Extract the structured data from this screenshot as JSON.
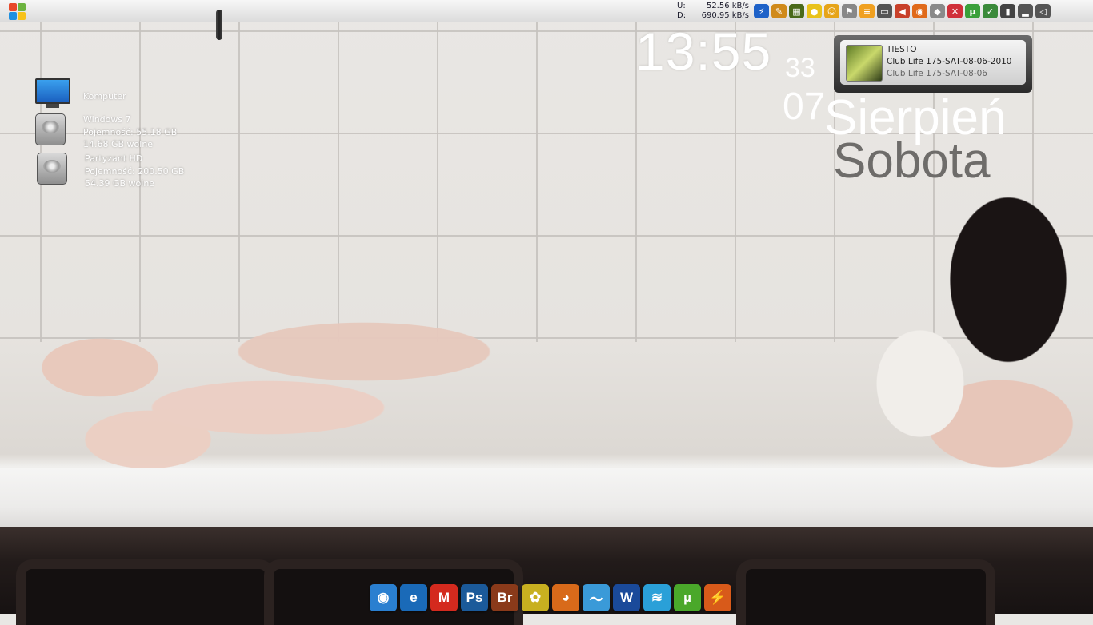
{
  "taskbar": {
    "net_upload_label": "U:",
    "net_upload_value": "52.56 kB/s",
    "net_download_label": "D:",
    "net_download_value": "690.95 kB/s"
  },
  "tray_icons": [
    {
      "name": "download-manager-icon",
      "glyph": "⚡",
      "color": "#1e62c8"
    },
    {
      "name": "ticket-icon",
      "glyph": "✎",
      "color": "#d08a1a"
    },
    {
      "name": "image-viewer-icon",
      "glyph": "▦",
      "color": "#4a6a1a"
    },
    {
      "name": "lightbulb-icon",
      "glyph": "●",
      "color": "#e9c21a"
    },
    {
      "name": "smiley-icon",
      "glyph": "☺",
      "color": "#e6a419"
    },
    {
      "name": "flag-icon",
      "glyph": "⚑",
      "color": "#888888"
    },
    {
      "name": "menu-icon",
      "glyph": "≡",
      "color": "#f0a020"
    },
    {
      "name": "projector-icon",
      "glyph": "▭",
      "color": "#555555"
    },
    {
      "name": "speaker-icon",
      "glyph": "◀",
      "color": "#c8402a"
    },
    {
      "name": "firefox-icon",
      "glyph": "◉",
      "color": "#e06a1a"
    },
    {
      "name": "droplet-icon",
      "glyph": "◆",
      "color": "#8a8a8a"
    },
    {
      "name": "stop-icon",
      "glyph": "✕",
      "color": "#d0303a"
    },
    {
      "name": "utorrent-tray-icon",
      "glyph": "µ",
      "color": "#3aa03a"
    },
    {
      "name": "security-shield-icon",
      "glyph": "✓",
      "color": "#3a8a3a"
    },
    {
      "name": "usb-icon",
      "glyph": "▮",
      "color": "#444444"
    },
    {
      "name": "signal-bars-icon",
      "glyph": "▂",
      "color": "#555555"
    },
    {
      "name": "volume-icon",
      "glyph": "◁",
      "color": "#555555"
    }
  ],
  "drives": [
    {
      "name": "Komputer"
    },
    {
      "name": "Windows 7",
      "capacity": "Pojemność: 55.18 GB",
      "free": "14.68 GB wolne"
    },
    {
      "name": "Partyzant HD",
      "capacity": "Pojemność: 200.50 GB",
      "free": "54.39 GB wolne"
    }
  ],
  "clock": {
    "time": "13:55",
    "seconds": "33",
    "day": "07",
    "month": "Sierpień",
    "weekday": "Sobota"
  },
  "player": {
    "artist": "TIESTO",
    "title": "Club Life 175-SAT-08-06-2010",
    "album": "Club Life 175-SAT-08-06"
  },
  "dock_apps": [
    {
      "name": "chrome-icon",
      "glyph": "◉",
      "color": "#2a7fd0"
    },
    {
      "name": "internet-explorer-icon",
      "glyph": "e",
      "color": "#1a6ab8"
    },
    {
      "name": "gmail-icon",
      "glyph": "M",
      "color": "#d42a1e"
    },
    {
      "name": "photoshop-icon",
      "glyph": "Ps",
      "color": "#1b5a9a"
    },
    {
      "name": "bridge-icon",
      "glyph": "Br",
      "color": "#8a3a1a"
    },
    {
      "name": "picasa-icon",
      "glyph": "✿",
      "color": "#c8b020"
    },
    {
      "name": "firefox-icon",
      "glyph": "◕",
      "color": "#d86a1a"
    },
    {
      "name": "mail-app-icon",
      "glyph": "〜",
      "color": "#3a9ad8"
    },
    {
      "name": "word-icon",
      "glyph": "W",
      "color": "#1a4a9a"
    },
    {
      "name": "wifi-icon",
      "glyph": "≋",
      "color": "#2aa0d8"
    },
    {
      "name": "utorrent-icon",
      "glyph": "µ",
      "color": "#4aa82a"
    },
    {
      "name": "winamp-icon",
      "glyph": "⚡",
      "color": "#d85a1a"
    }
  ]
}
